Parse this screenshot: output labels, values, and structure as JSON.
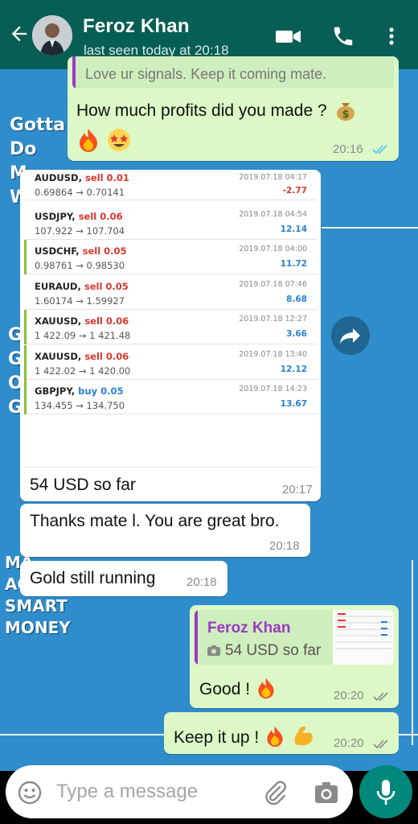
{
  "header": {
    "contact_name": "Feroz Khan",
    "status": "last seen today at 20:18"
  },
  "wallpaper": {
    "lines_top": [
      "Gotta",
      "Do",
      "M",
      "W"
    ],
    "lines_mid": [
      "G",
      "G",
      "O",
      "G"
    ],
    "lines_bottom": [
      "MA",
      "AC",
      "SMART",
      "MONEY"
    ]
  },
  "messages": {
    "quoted_prev": "Love ur signals. Keep it coming mate.",
    "profit_question": "How much profits did you made ?",
    "profit_question_time": "20:16",
    "trades": [
      {
        "symbol": "AUDUSD,",
        "side": "sell 0.01",
        "side_type": "sell",
        "prices": "0.69864 → 0.70141",
        "date": "2019.07.18 04:17",
        "pl": "-2.77",
        "pl_type": "neg",
        "marked": false
      },
      {
        "symbol": "USDJPY,",
        "side": "sell 0.06",
        "side_type": "sell",
        "prices": "107.922 → 107.704",
        "date": "2019.07.18 04:54",
        "pl": "12.14",
        "pl_type": "pos",
        "marked": false
      },
      {
        "symbol": "USDCHF,",
        "side": "sell 0.05",
        "side_type": "sell",
        "prices": "0.98761 → 0.98530",
        "date": "2019.07.18 04:00",
        "pl": "11.72",
        "pl_type": "pos",
        "marked": true
      },
      {
        "symbol": "EURAUD,",
        "side": "sell 0.05",
        "side_type": "sell",
        "prices": "1.60174 → 1.59927",
        "date": "2019.07.18 07:46",
        "pl": "8.68",
        "pl_type": "pos",
        "marked": false
      },
      {
        "symbol": "XAUUSD,",
        "side": "sell 0.06",
        "side_type": "sell",
        "prices": "1 422.09 → 1 421.48",
        "date": "2019.07.18 12:27",
        "pl": "3.66",
        "pl_type": "pos",
        "marked": true
      },
      {
        "symbol": "XAUUSD,",
        "side": "sell 0.06",
        "side_type": "sell",
        "prices": "1 422.02 → 1 420.00",
        "date": "2019.07.18 13:40",
        "pl": "12.12",
        "pl_type": "pos",
        "marked": true
      },
      {
        "symbol": "GBPJPY,",
        "side": "buy 0.05",
        "side_type": "buy",
        "prices": "134.455 → 134.750",
        "date": "2019.07.18 14:23",
        "pl": "13.67",
        "pl_type": "pos",
        "marked": true
      }
    ],
    "image_caption": "54 USD so far",
    "image_caption_time": "20:17",
    "thanks": "Thanks mate l. You are great bro.",
    "thanks_time": "20:18",
    "gold": "Gold still running",
    "gold_time": "20:18",
    "reply_quote_author": "Feroz Khan",
    "reply_quote_text": "54 USD so far",
    "good": "Good !",
    "good_time": "20:20",
    "keep": "Keep it up !",
    "keep_time": "20:20"
  },
  "input": {
    "placeholder": "Type a message"
  },
  "icons": {
    "back": "arrow-left-icon",
    "video": "video-call-icon",
    "call": "phone-icon",
    "menu": "more-vert-icon",
    "emoji": "emoji-icon",
    "attach": "paperclip-icon",
    "camera": "camera-icon",
    "mic": "microphone-icon",
    "forward": "forward-icon"
  },
  "colors": {
    "header": "#075e54",
    "outgoing_bubble": "#dcf8c6",
    "incoming_bubble": "#ffffff",
    "read_ticks": "#4fc3f7",
    "mic_button": "#00897b",
    "quote_author": "#9b39c4"
  }
}
